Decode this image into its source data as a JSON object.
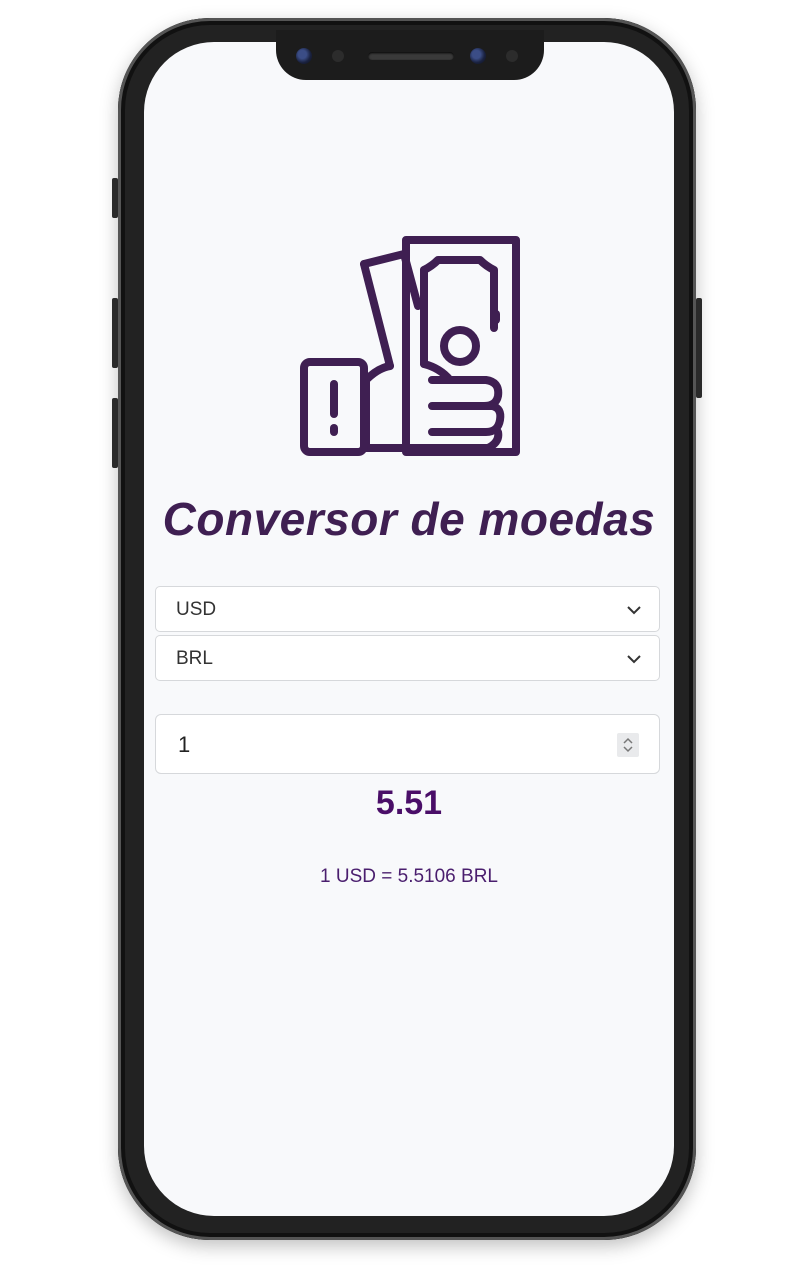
{
  "app": {
    "title": "Conversor de moedas",
    "icon": "money-in-hand-icon",
    "accent_color": "#3f1f52"
  },
  "converter": {
    "from_currency": "USD",
    "to_currency": "BRL",
    "amount": "1",
    "result": "5.51",
    "rate_text": "1 USD = 5.5106 BRL"
  }
}
